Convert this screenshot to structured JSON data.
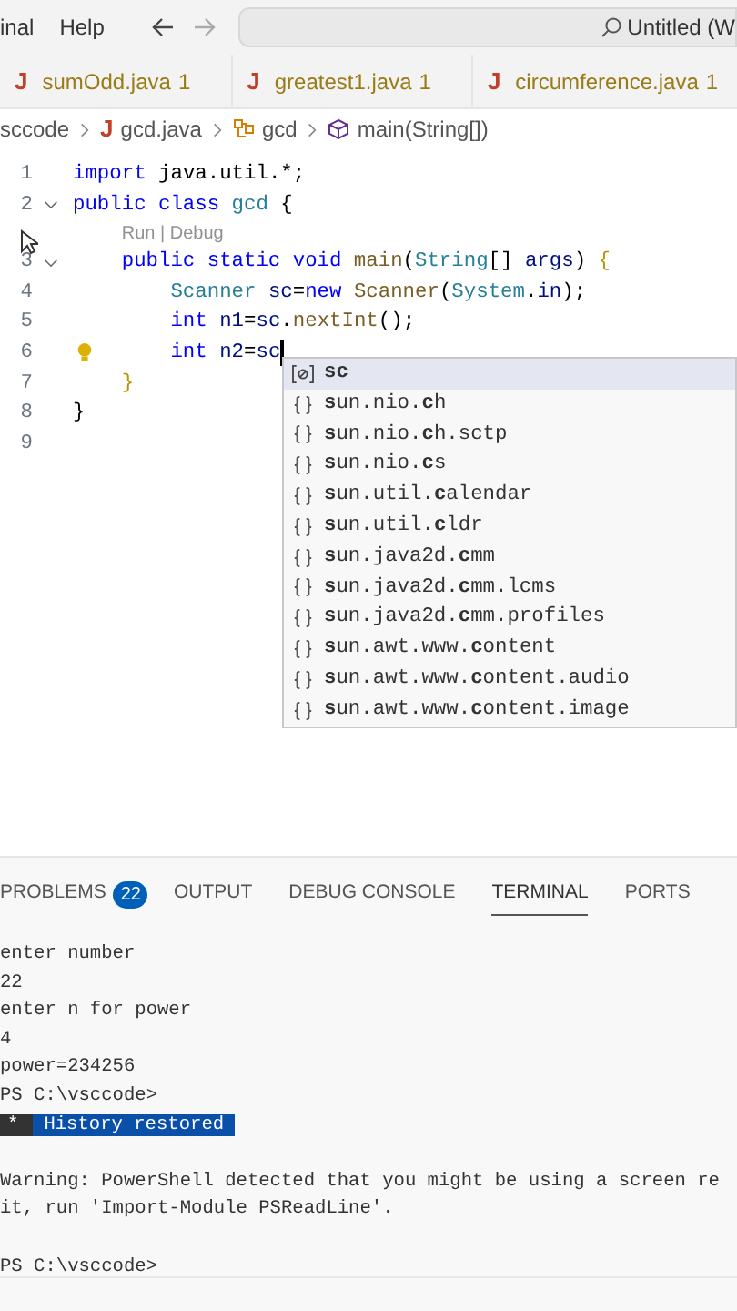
{
  "menu": [
    "inal",
    "Help"
  ],
  "search": {
    "value": "Untitled (W"
  },
  "tabs": [
    {
      "icon": "J",
      "label": "sumOdd.java",
      "count": "1"
    },
    {
      "icon": "J",
      "label": "greatest1.java",
      "count": "1"
    },
    {
      "icon": "J",
      "label": "circumference.java",
      "count": "1"
    }
  ],
  "breadcrumb": [
    {
      "kind": "folder",
      "label": "sccode"
    },
    {
      "kind": "file",
      "icon": "J",
      "label": "gcd.java"
    },
    {
      "kind": "class",
      "label": "gcd"
    },
    {
      "kind": "method",
      "label": "main(String[])"
    }
  ],
  "editor": {
    "lines": [
      {
        "number": "1",
        "tokens": [
          {
            "text": "import",
            "kind": "keyword"
          },
          {
            "text": " java.util.*;",
            "kind": "plain"
          }
        ]
      },
      {
        "number": "2",
        "fold": true,
        "tokens": [
          {
            "text": "public class ",
            "kind": "keyword"
          },
          {
            "text": "gcd",
            "kind": "type"
          },
          {
            "text": " {",
            "kind": "plain"
          }
        ]
      },
      {
        "kind": "codelens",
        "text": "    Run | Debug"
      },
      {
        "number": "3",
        "fold": true,
        "cursor_icon": true,
        "tokens": [
          {
            "text": "    public static void ",
            "kind": "keyword"
          },
          {
            "text": "main",
            "kind": "function"
          },
          {
            "text": "(",
            "kind": "plain"
          },
          {
            "text": "String",
            "kind": "type"
          },
          {
            "text": "[] ",
            "kind": "plain"
          },
          {
            "text": "args",
            "kind": "variable"
          },
          {
            "text": ") ",
            "kind": "plain"
          },
          {
            "text": "{",
            "kind": "brace"
          }
        ]
      },
      {
        "number": "4",
        "tokens": [
          {
            "text": "        Scanner ",
            "kind": "type"
          },
          {
            "text": "sc",
            "kind": "variable"
          },
          {
            "text": "=",
            "kind": "plain"
          },
          {
            "text": "new ",
            "kind": "keyword"
          },
          {
            "text": "Scanner",
            "kind": "function"
          },
          {
            "text": "(",
            "kind": "plain"
          },
          {
            "text": "System",
            "kind": "type"
          },
          {
            "text": ".",
            "kind": "plain"
          },
          {
            "text": "in",
            "kind": "variable"
          },
          {
            "text": ");",
            "kind": "plain"
          }
        ]
      },
      {
        "number": "5",
        "tokens": [
          {
            "text": "        int ",
            "kind": "keyword"
          },
          {
            "text": "n1",
            "kind": "variable"
          },
          {
            "text": "=",
            "kind": "plain"
          },
          {
            "text": "sc",
            "kind": "variable"
          },
          {
            "text": ".",
            "kind": "plain"
          },
          {
            "text": "nextInt",
            "kind": "function"
          },
          {
            "text": "();",
            "kind": "plain"
          }
        ]
      },
      {
        "number": "6",
        "lightbulb": true,
        "current": true,
        "tokens": [
          {
            "text": "        int ",
            "kind": "keyword"
          },
          {
            "text": "n2",
            "kind": "variable"
          },
          {
            "text": "=",
            "kind": "plain"
          },
          {
            "text": "sc",
            "kind": "variable"
          }
        ]
      },
      {
        "number": "7",
        "tokens": [
          {
            "text": "    }",
            "kind": "brace"
          }
        ]
      },
      {
        "number": "8",
        "tokens": [
          {
            "text": "}",
            "kind": "plain"
          }
        ]
      },
      {
        "number": "9"
      }
    ]
  },
  "suggestions": [
    {
      "kind": "variable",
      "label": "**sc**",
      "selected": true
    },
    {
      "kind": "module",
      "label": "**s**un.nio.**c**h",
      "selected": false
    },
    {
      "kind": "module",
      "label": "**s**un.nio.**c**h.sctp",
      "selected": false
    },
    {
      "kind": "module",
      "label": "**s**un.nio.**c**s",
      "selected": false
    },
    {
      "kind": "module",
      "label": "**s**un.util.**c**alendar",
      "selected": false
    },
    {
      "kind": "module",
      "label": "**s**un.util.**c**ldr",
      "selected": false
    },
    {
      "kind": "module",
      "label": "**s**un.java2d.**c**mm",
      "selected": false
    },
    {
      "kind": "module",
      "label": "**s**un.java2d.**c**mm.lcms",
      "selected": false
    },
    {
      "kind": "module",
      "label": "**s**un.java2d.**c**mm.profiles",
      "selected": false
    },
    {
      "kind": "module",
      "label": "**s**un.awt.www.**c**ontent",
      "selected": false
    },
    {
      "kind": "module",
      "label": "**s**un.awt.www.**c**ontent.audio",
      "selected": false
    },
    {
      "kind": "module",
      "label": "**s**un.awt.www.**c**ontent.image",
      "selected": false
    }
  ],
  "panel_tabs": [
    {
      "label": "PROBLEMS",
      "badge": "22",
      "selected": false
    },
    {
      "label": "OUTPUT",
      "selected": false
    },
    {
      "label": "DEBUG CONSOLE",
      "selected": false
    },
    {
      "label": "TERMINAL",
      "selected": true
    },
    {
      "label": "PORTS",
      "selected": false
    }
  ],
  "terminal": [
    {
      "kind": "text",
      "text": "enter number"
    },
    {
      "kind": "text",
      "text": "22"
    },
    {
      "kind": "text",
      "text": "enter n for power"
    },
    {
      "kind": "text",
      "text": "4"
    },
    {
      "kind": "text",
      "text": "power=234256"
    },
    {
      "kind": "text",
      "text": "PS C:\\vsccode>"
    },
    {
      "kind": "highlight",
      "prefix": "*",
      "text": "History restored"
    },
    {
      "kind": "blank"
    },
    {
      "kind": "text",
      "text": "Warning: PowerShell detected that you might be using a screen re"
    },
    {
      "kind": "text",
      "text": "it, run 'Import-Module PSReadLine'."
    },
    {
      "kind": "blank"
    },
    {
      "kind": "text",
      "text": "PS C:\\vsccode>"
    }
  ]
}
